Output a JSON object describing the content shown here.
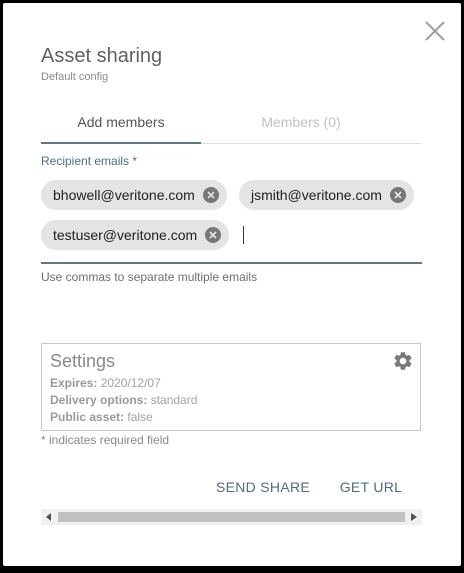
{
  "dialog": {
    "title": "Asset sharing",
    "subtitle": "Default config",
    "close_icon": "close-icon"
  },
  "tabs": [
    {
      "label": "Add members",
      "active": true
    },
    {
      "label": "Members (0)",
      "active": false
    }
  ],
  "recipients": {
    "label": "Recipient emails *",
    "chips": [
      {
        "email": "bhowell@veritone.com"
      },
      {
        "email": "jsmith@veritone.com"
      },
      {
        "email": "testuser@veritone.com"
      }
    ],
    "helper": "Use commas to separate multiple emails"
  },
  "settings": {
    "title": "Settings",
    "gear_icon": "gear-icon",
    "expires_label": "Expires:",
    "expires_value": "2020/12/07",
    "delivery_label": "Delivery options:",
    "delivery_value": "standard",
    "public_label": "Public asset:",
    "public_value": "false"
  },
  "required_note": "* indicates required field",
  "actions": {
    "send_share": "SEND SHARE",
    "get_url": "GET URL"
  },
  "colors": {
    "accent": "#5b7a86",
    "chip_bg": "#e4e4e4"
  }
}
